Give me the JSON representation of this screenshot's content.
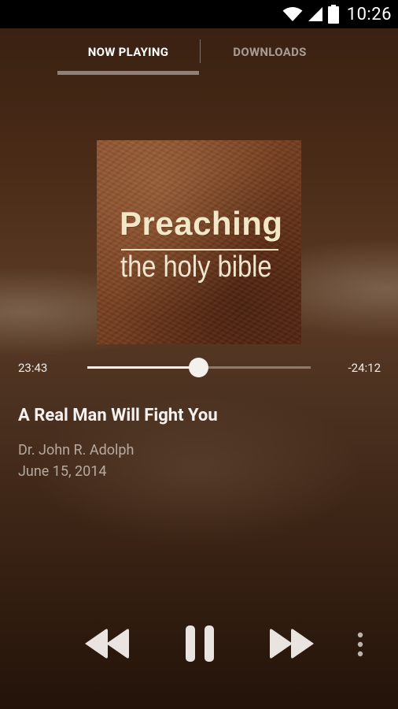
{
  "status_bar": {
    "time": "10:26",
    "icons": [
      "wifi-icon",
      "cell-signal-icon",
      "battery-icon"
    ]
  },
  "tabs": [
    {
      "label": "NOW PLAYING",
      "active": true
    },
    {
      "label": "DOWNLOADS",
      "active": false
    }
  ],
  "album_art": {
    "title": "Preaching",
    "subtitle": "the holy bible"
  },
  "player": {
    "elapsed": "23:43",
    "remaining": "-24:12",
    "progress": 0.495
  },
  "track": {
    "title": "A Real Man Will Fight You",
    "artist": "Dr. John R. Adolph",
    "date": "June 15, 2014"
  },
  "controls": [
    "rewind-icon",
    "pause-icon",
    "fast-forward-icon",
    "more-vert-icon"
  ],
  "colors": {
    "background": "#4a2b17",
    "accent": "#f4f0ec"
  }
}
